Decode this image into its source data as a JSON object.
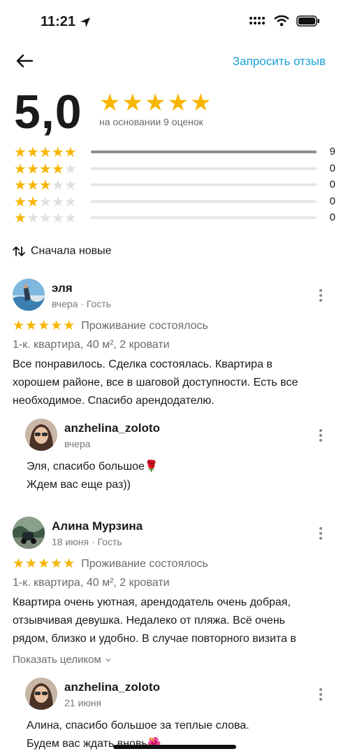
{
  "status": {
    "time": "11:21"
  },
  "nav": {
    "request_review": "Запросить отзыв"
  },
  "summary": {
    "score": "5,0",
    "based_on": "на основании 9 оценок",
    "stars": 5
  },
  "distribution": [
    {
      "stars": 5,
      "count": "9",
      "fraction": 1.0
    },
    {
      "stars": 4,
      "count": "0",
      "fraction": 0
    },
    {
      "stars": 3,
      "count": "0",
      "fraction": 0
    },
    {
      "stars": 2,
      "count": "0",
      "fraction": 0
    },
    {
      "stars": 1,
      "count": "0",
      "fraction": 0
    }
  ],
  "sort": {
    "label": "Сначала новые"
  },
  "reviews": [
    {
      "name": "эля",
      "meta": "вчера · Гость",
      "rating": 5,
      "status": "Проживание состоялось",
      "details": "1-к. квартира, 40 м², 2 кровати",
      "text_lines": [
        "Все  понравилось. Сделка состоялась. Квартира в",
        "хорошем районе, все в шаговой доступности. Есть все",
        "необходимое. Спасибо арендодателю."
      ],
      "reply": {
        "name": "anzhelina_zoloto",
        "meta": "вчера",
        "text_lines": [
          "Эля, спасибо большое🌹",
          "Ждем вас еще раз))"
        ]
      }
    },
    {
      "name": "Алина Мурзина",
      "meta": "18 июня · Гость",
      "rating": 5,
      "status": "Проживание состоялось",
      "details": "1-к. квартира, 40 м², 2 кровати",
      "text_lines": [
        "Квартира очень уютная, арендодатель очень добрая,",
        "отзывчивая девушка. Недалеко от пляжа. Всё очень",
        "рядом, близко и удобно. В случае повторного визита в"
      ],
      "show_more": "Показать целиком",
      "reply": {
        "name": "anzhelina_zoloto",
        "meta": "21 июня",
        "text_lines": [
          "Алина, спасибо большое за теплые слова.",
          "Будем вас ждать вновь🌺"
        ]
      }
    }
  ],
  "colors": {
    "accent": "#1aa0d6",
    "star": "#f7b500",
    "star_off": "#e0e0e0"
  }
}
